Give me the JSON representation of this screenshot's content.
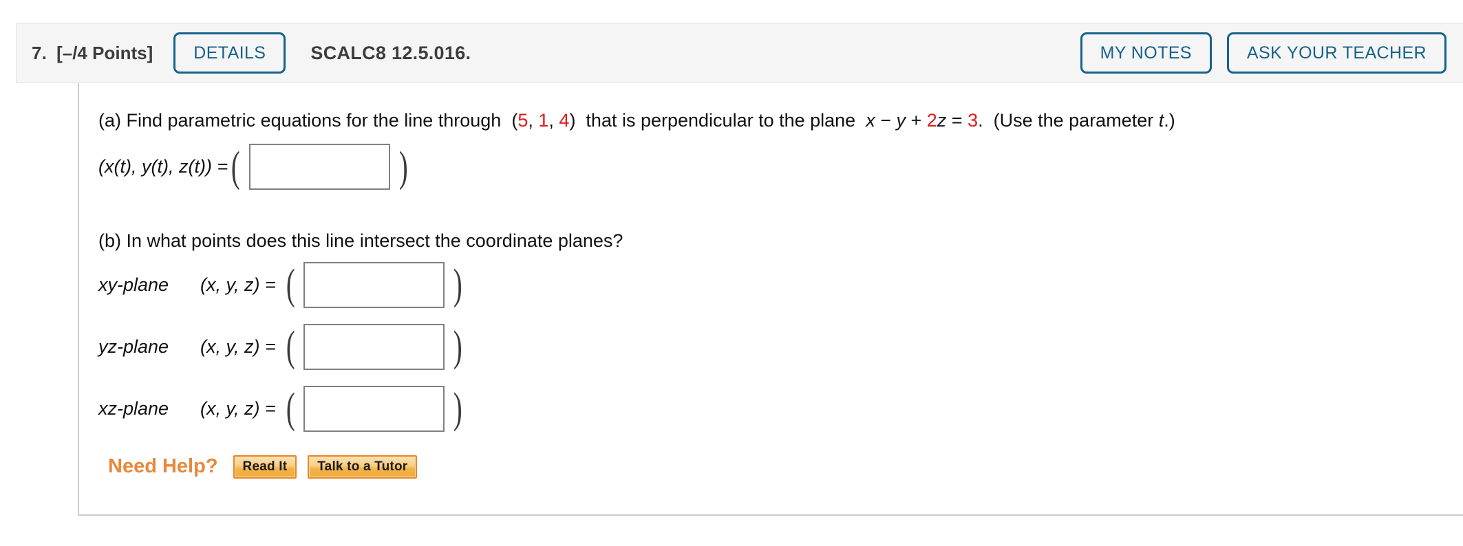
{
  "header": {
    "question_number": "7.",
    "points_label": "[–/4 Points]",
    "details_label": "DETAILS",
    "problem_code": "SCALC8 12.5.016.",
    "my_notes_label": "MY NOTES",
    "ask_your_teacher_label": "ASK YOUR TEACHER",
    "accent_color": "#15628c",
    "background_color": "#f5f5f5"
  },
  "part_a": {
    "prefix": "(a) Find parametric equations for the line through  (",
    "point_x": "5",
    "sep1": ", ",
    "point_y": "1",
    "sep2": ", ",
    "point_z": "4",
    "middle": ")  that is perpendicular to the plane  ",
    "plane_x": "x",
    "plane_op1": " − ",
    "plane_y": "y",
    "plane_op2": " + ",
    "plane_coeff": "2",
    "plane_z": "z",
    "plane_eq": " = ",
    "plane_rhs": "3",
    "suffix": ".  (Use the parameter ",
    "parameter": "t",
    "end": ".)",
    "answer_label": "(x(t), y(t), z(t)) =",
    "answer_value": "",
    "open_paren": "(",
    "close_paren": ")"
  },
  "part_b": {
    "question": "(b) In what points does this line intersect the coordinate planes?",
    "coord_label": "(x, y, z) =",
    "open_paren": "(",
    "close_paren": ")",
    "rows": [
      {
        "plane": "xy-plane",
        "value": ""
      },
      {
        "plane": "yz-plane",
        "value": ""
      },
      {
        "plane": "xz-plane",
        "value": ""
      }
    ]
  },
  "need_help": {
    "label": "Need Help?",
    "read_it_label": "Read It",
    "talk_to_tutor_label": "Talk to a Tutor",
    "accent_color": "#e8883a"
  },
  "colors": {
    "red_value": "#e01b1b",
    "input_border": "#808080",
    "body_border": "#cccccc"
  }
}
